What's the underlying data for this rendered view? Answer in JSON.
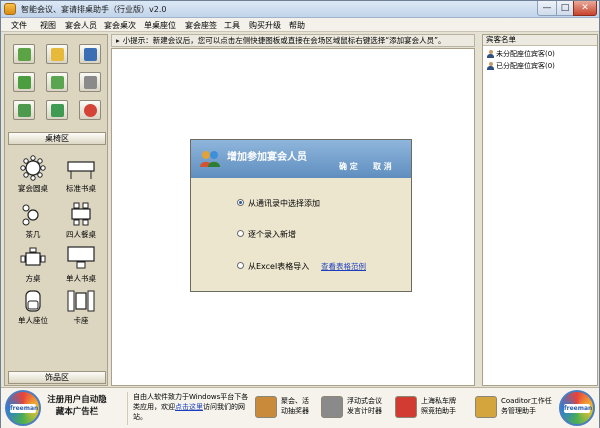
{
  "window": {
    "title": "智能会议、宴请排桌助手（行业版）v2.0",
    "min_label": "—",
    "max_label": "□",
    "close_label": "✕"
  },
  "menu": [
    "文件",
    "视图",
    "宴会人员",
    "宴会桌次",
    "单桌座位",
    "宴会座签",
    "工具",
    "购买升级",
    "帮助"
  ],
  "toolbar": {
    "buttons": [
      {
        "icon": "new-plus-icon",
        "color": "#5ba345"
      },
      {
        "icon": "open-folder-icon",
        "color": "#e6b93a"
      },
      {
        "icon": "save-disk-icon",
        "color": "#3b6fb5"
      },
      {
        "icon": "add-person-icon",
        "color": "#4c9d3f"
      },
      {
        "icon": "layout-green-icon",
        "color": "#5aa650"
      },
      {
        "icon": "printer-icon",
        "color": "#8a8a8a"
      },
      {
        "icon": "export-arrow-icon",
        "color": "#4d9a4e"
      },
      {
        "icon": "currency-icon",
        "color": "#3f9b52"
      },
      {
        "icon": "power-icon",
        "color": "#d44336"
      }
    ]
  },
  "left_panel": {
    "tables_header": "桌椅区",
    "items": [
      {
        "label": "宴会圆桌"
      },
      {
        "label": "标准书桌"
      },
      {
        "label": "茶几"
      },
      {
        "label": "四人餐桌"
      },
      {
        "label": "方桌"
      },
      {
        "label": "单人书桌"
      },
      {
        "label": "单人座位"
      },
      {
        "label": "卡座"
      }
    ],
    "decor_header": "饰品区"
  },
  "hint": {
    "icon": "triangle-right-icon",
    "text": "小提示：新建会议后，您可以点击左侧快捷图板或直接在会场区域鼠标右键选择“添加宴会人员”。"
  },
  "dialog": {
    "title": "增加参加宴会人员",
    "confirm": "确 定",
    "cancel": "取 消",
    "options": [
      {
        "label": "从通讯录中选择添加",
        "checked": true
      },
      {
        "label": "逐个录入新增",
        "checked": false
      },
      {
        "label": "从Excel表格导入",
        "checked": false
      }
    ],
    "link": "查看表格范例"
  },
  "guest_panel": {
    "header": "宾客名单",
    "items": [
      {
        "label": "未分配座位宾客(0)"
      },
      {
        "label": "已分配座位宾客(0)"
      }
    ]
  },
  "adbar": {
    "logo_text": "freeman",
    "register_text": "注册用户自动隐藏本广告栏",
    "desc_before": "自由人软件致力于Windows平台下各类应用，欢迎",
    "desc_link": "点击这里",
    "desc_after": "访问我们的网站。",
    "products": [
      {
        "label": "聚会、活\n动抽奖器",
        "color": "#c98a3a"
      },
      {
        "label": "浮动式会议\n发言计时器",
        "color": "#8a8a8a"
      },
      {
        "label": "上海私车牌\n照竞拍助手",
        "color": "#d13b32"
      },
      {
        "label": "Coaditor工作任\n务管理助手",
        "color": "#d4a53c"
      }
    ]
  }
}
